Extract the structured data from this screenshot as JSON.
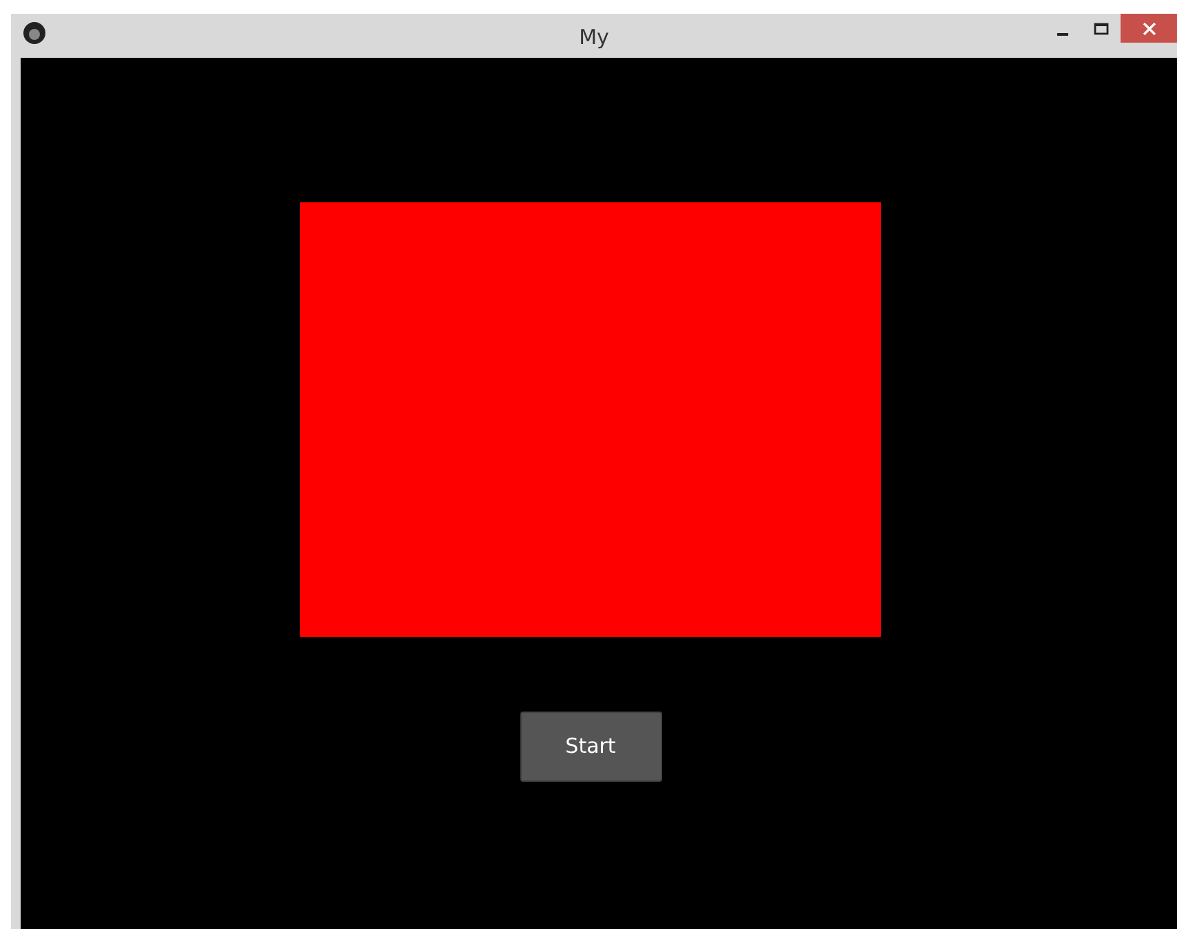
{
  "window": {
    "title": "My"
  },
  "canvas": {
    "shape": {
      "kind": "rectangle"
    }
  },
  "buttons": [
    {
      "label": "Start"
    }
  ]
}
